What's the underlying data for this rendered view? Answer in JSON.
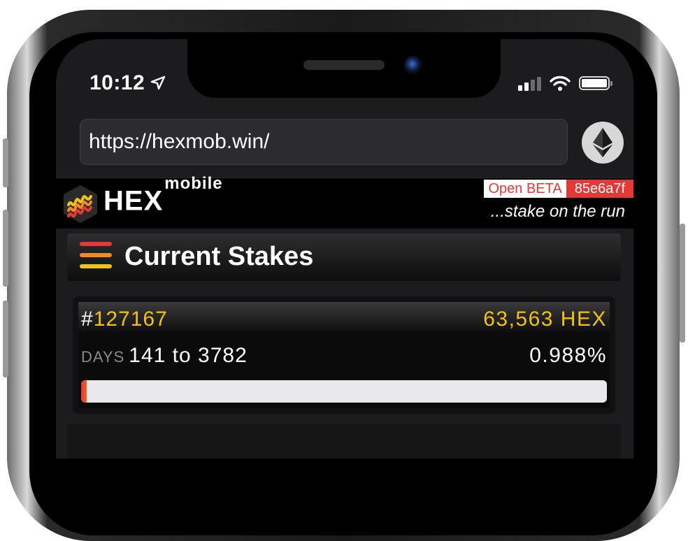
{
  "status_bar": {
    "time": "10:12",
    "location_icon": "location-arrow-icon",
    "wifi_icon": "wifi-icon",
    "battery_icon": "battery-icon",
    "signal_icon": "cellular-signal-icon"
  },
  "browser": {
    "url": "https://hexmob.win/",
    "wallet_icon": "ethereum-icon"
  },
  "app_header": {
    "brand": "HEX",
    "brand_sup": "mobile",
    "beta_label": "Open BETA",
    "build_hash": "85e6a7f",
    "tagline": "...stake on the run"
  },
  "section": {
    "title": "Current Stakes",
    "menu_colors": [
      "#e53935",
      "#f28a2a",
      "#f4c20d"
    ]
  },
  "stake": {
    "hash_sign": "#",
    "id": "127167",
    "amount": "63,563 HEX",
    "days_label": "DAYS",
    "days_range": "141 to 3782",
    "percent": "0.988%",
    "progress": 0.00988
  },
  "colors": {
    "accent_gold": "#f4c20d",
    "accent_red": "#e53935"
  }
}
